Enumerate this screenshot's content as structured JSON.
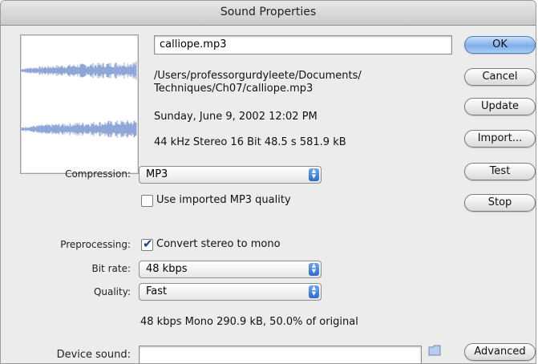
{
  "window": {
    "title": "Sound Properties"
  },
  "file": {
    "name": "calliope.mp3",
    "path_line1": "/Users/professorgurdyleete/Documents/",
    "path_line2": "Techniques/Ch07/calliope.mp3",
    "date": "Sunday, June 9, 2002  12:02 PM",
    "info": "44 kHz Stereo 16 Bit 48.5 s 581.9 kB"
  },
  "buttons": {
    "ok": "OK",
    "cancel": "Cancel",
    "update": "Update",
    "import": "Import...",
    "test": "Test",
    "stop": "Stop",
    "advanced": "Advanced"
  },
  "compression": {
    "label": "Compression:",
    "value": "MP3",
    "use_imported_label": "Use imported MP3 quality",
    "use_imported_checked": false
  },
  "preprocessing": {
    "label": "Preprocessing:",
    "convert_label": "Convert stereo to mono",
    "convert_checked": true
  },
  "bitrate": {
    "label": "Bit rate:",
    "value": "48 kbps"
  },
  "quality": {
    "label": "Quality:",
    "value": "Fast"
  },
  "summary": "48 kbps  Mono 290.9 kB, 50.0% of original",
  "device_sound": {
    "label": "Device sound:",
    "value": ""
  },
  "colors": {
    "waveform": "#8fa6d6",
    "accent": "#3a73d6"
  },
  "icons": [
    "waveform-preview",
    "popup-arrows-icon",
    "checkmark-icon",
    "folder-icon"
  ]
}
